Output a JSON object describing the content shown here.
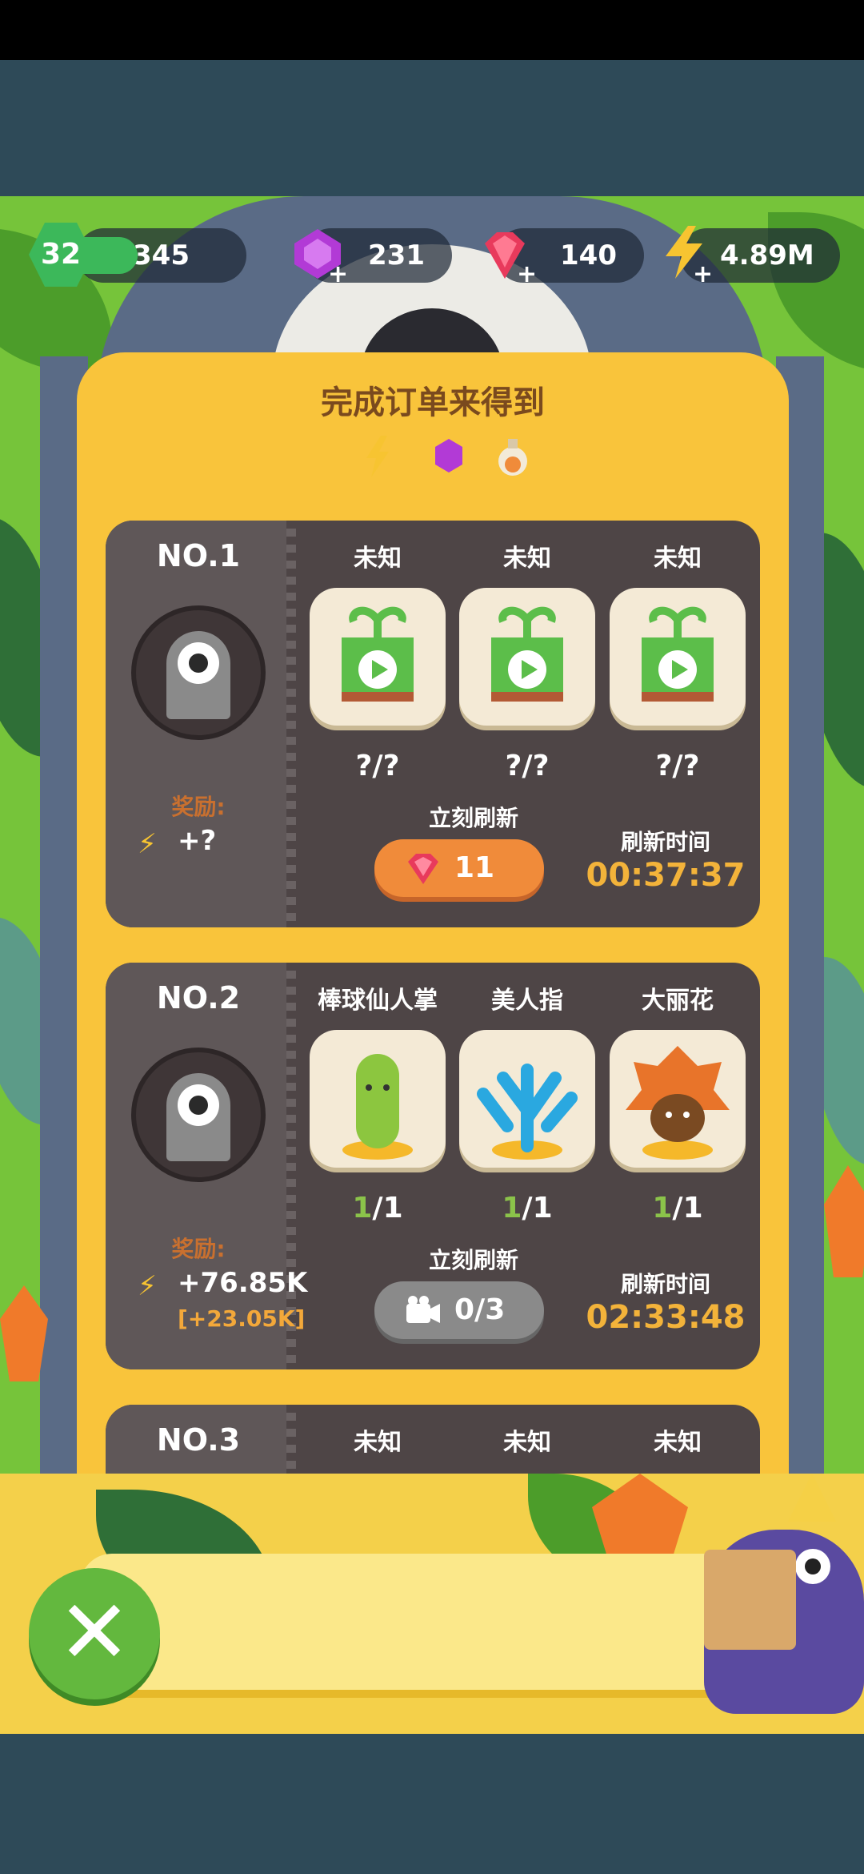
{
  "hud": {
    "level": "32",
    "xp": "345",
    "purple_gems": "231",
    "red_gems": "140",
    "energy": "4.89M"
  },
  "panel": {
    "title": "完成订单来得到"
  },
  "orders": [
    {
      "number": "NO.1",
      "reward_label": "奖励:",
      "reward_value": "+?",
      "reward_bonus": "",
      "items": [
        {
          "name": "未知",
          "count": "?/?",
          "icon": "sprout-play-icon"
        },
        {
          "name": "未知",
          "count": "?/?",
          "icon": "sprout-play-icon"
        },
        {
          "name": "未知",
          "count": "?/?",
          "icon": "sprout-play-icon"
        }
      ],
      "refresh_label": "立刻刷新",
      "refresh_button": "11",
      "time_label": "刷新时间",
      "time_value": "00:37:37"
    },
    {
      "number": "NO.2",
      "reward_label": "奖励:",
      "reward_value": "+76.85K",
      "reward_bonus": "[+23.05K]",
      "items": [
        {
          "name": "棒球仙人掌",
          "count_done": "1",
          "count_total": "/1",
          "icon": "cactus-icon"
        },
        {
          "name": "美人指",
          "count_done": "1",
          "count_total": "/1",
          "icon": "coral-plant-icon"
        },
        {
          "name": "大丽花",
          "count_done": "1",
          "count_total": "/1",
          "icon": "dahlia-icon"
        }
      ],
      "refresh_label": "立刻刷新",
      "refresh_button": "0/3",
      "time_label": "刷新时间",
      "time_value": "02:33:48"
    },
    {
      "number": "NO.3",
      "items": [
        {
          "name": "未知"
        },
        {
          "name": "未知"
        },
        {
          "name": "未知"
        }
      ]
    }
  ],
  "colors": {
    "panel": "#f9c43b",
    "card": "#4e4546",
    "accent_orange": "#f08b3a",
    "time_yellow": "#f3b33a",
    "done_green": "#8bc34a"
  }
}
